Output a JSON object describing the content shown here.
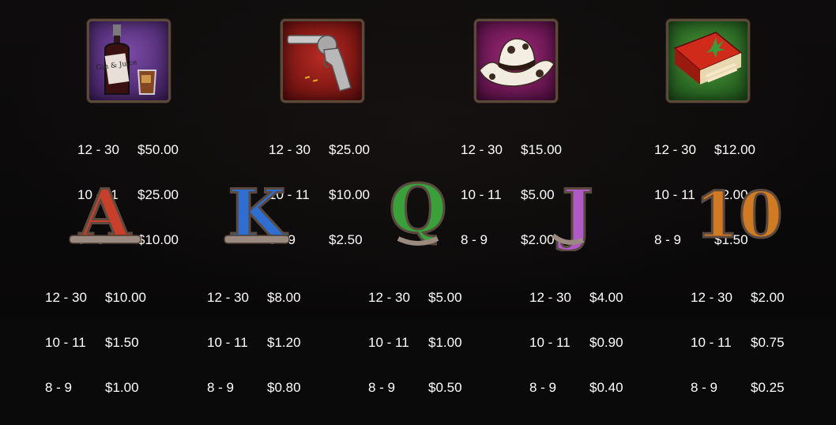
{
  "symbols": [
    {
      "name": "Gin & Juice",
      "label": "Gin & Juice",
      "icon": "whiskey-bottle-icon",
      "tile_color": "#4a2a6a",
      "pays": [
        {
          "range": "12 - 30",
          "value": "$50.00"
        },
        {
          "range": "10 - 11",
          "value": "$25.00"
        },
        {
          "range": "8 - 9",
          "value": "$10.00"
        }
      ]
    },
    {
      "name": "Revolver",
      "icon": "revolver-icon",
      "tile_color": "#8a1a1a",
      "pays": [
        {
          "range": "12 - 30",
          "value": "$25.00"
        },
        {
          "range": "10 - 11",
          "value": "$10.00"
        },
        {
          "range": "8 - 9",
          "value": "$2.50"
        }
      ]
    },
    {
      "name": "Cowboy Hat",
      "icon": "cowboy-hat-icon",
      "tile_color": "#7a1a5a",
      "pays": [
        {
          "range": "12 - 30",
          "value": "$15.00"
        },
        {
          "range": "10 - 11",
          "value": "$5.00"
        },
        {
          "range": "8 - 9",
          "value": "$2.00"
        }
      ]
    },
    {
      "name": "Joint Box",
      "icon": "joint-box-icon",
      "tile_color": "#2a6a2a",
      "pays": [
        {
          "range": "12 - 30",
          "value": "$12.00"
        },
        {
          "range": "10 - 11",
          "value": "$2.00"
        },
        {
          "range": "8 - 9",
          "value": "$1.50"
        }
      ]
    },
    {
      "name": "A",
      "letter": "A",
      "color": "#c8402a",
      "pays": [
        {
          "range": "12 - 30",
          "value": "$10.00"
        },
        {
          "range": "10 - 11",
          "value": "$1.50"
        },
        {
          "range": "8 - 9",
          "value": "$1.00"
        }
      ]
    },
    {
      "name": "K",
      "letter": "K",
      "color": "#2e6ed0",
      "pays": [
        {
          "range": "12 - 30",
          "value": "$8.00"
        },
        {
          "range": "10 - 11",
          "value": "$1.20"
        },
        {
          "range": "8 - 9",
          "value": "$0.80"
        }
      ]
    },
    {
      "name": "Q",
      "letter": "Q",
      "color": "#3aa03a",
      "pays": [
        {
          "range": "12 - 30",
          "value": "$5.00"
        },
        {
          "range": "10 - 11",
          "value": "$1.00"
        },
        {
          "range": "8 - 9",
          "value": "$0.50"
        }
      ]
    },
    {
      "name": "J",
      "letter": "J",
      "color": "#b05ac8",
      "pays": [
        {
          "range": "12 - 30",
          "value": "$4.00"
        },
        {
          "range": "10 - 11",
          "value": "$0.90"
        },
        {
          "range": "8 - 9",
          "value": "$0.40"
        }
      ]
    },
    {
      "name": "10",
      "letter": "10",
      "color": "#d27a22",
      "pays": [
        {
          "range": "12 - 30",
          "value": "$2.00"
        },
        {
          "range": "10 - 11",
          "value": "$0.75"
        },
        {
          "range": "8 - 9",
          "value": "$0.25"
        }
      ]
    }
  ]
}
